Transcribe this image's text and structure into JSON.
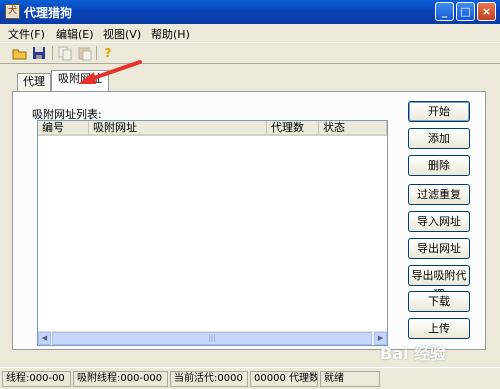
{
  "window": {
    "title": "代理猎狗"
  },
  "menu": [
    "文件(F)",
    "编辑(E)",
    "视图(V)",
    "帮助(H)"
  ],
  "toolbar": {
    "icons": [
      "open-folder-icon",
      "save-icon",
      "copy-icon",
      "paste-icon",
      "help-icon"
    ]
  },
  "tabs": [
    {
      "label": "代理"
    },
    {
      "label": "吸附网址"
    }
  ],
  "list": {
    "title": "吸附网址列表:",
    "columns": [
      "编号",
      "吸附网址",
      "代理数",
      "状态"
    ]
  },
  "buttons": [
    "开始",
    "添加",
    "删除",
    "过滤重复",
    "导入网址",
    "导出网址",
    "导出吸附代理",
    "下载",
    "上传"
  ],
  "status": [
    "线程:000-00",
    "吸附线程:000-000",
    "当前活代:0000",
    "00000 代理数",
    "就绪"
  ],
  "watermark": "Bai 经验"
}
